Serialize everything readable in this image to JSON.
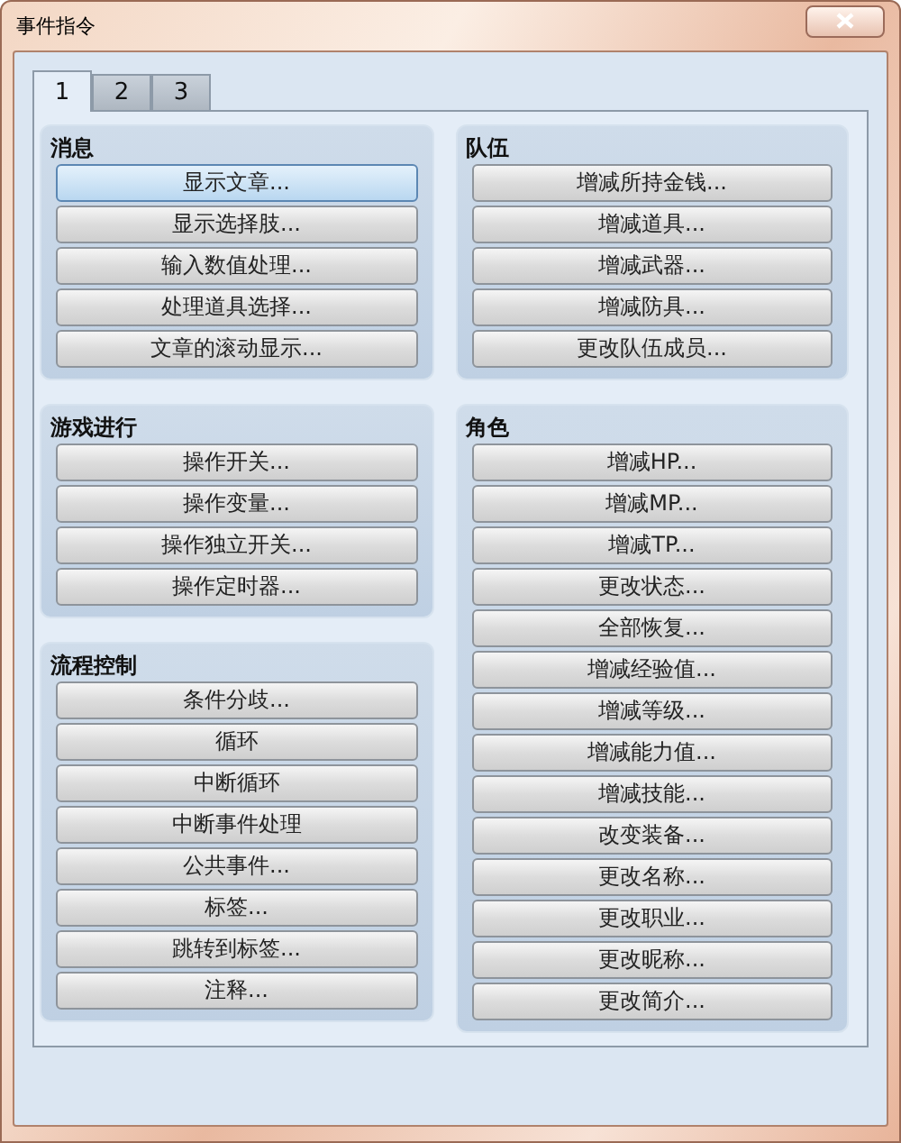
{
  "window": {
    "title": "事件指令"
  },
  "tabs": [
    {
      "label": "1",
      "selected": true
    },
    {
      "label": "2",
      "selected": false
    },
    {
      "label": "3",
      "selected": false
    }
  ],
  "columns": [
    [
      {
        "title": "消息",
        "buttons": [
          {
            "label": "显示文章...",
            "selected": true
          },
          {
            "label": "显示选择肢...",
            "selected": false
          },
          {
            "label": "输入数值处理...",
            "selected": false
          },
          {
            "label": "处理道具选择...",
            "selected": false
          },
          {
            "label": "文章的滚动显示...",
            "selected": false
          }
        ]
      },
      {
        "title": "游戏进行",
        "buttons": [
          {
            "label": "操作开关...",
            "selected": false
          },
          {
            "label": "操作变量...",
            "selected": false
          },
          {
            "label": "操作独立开关...",
            "selected": false
          },
          {
            "label": "操作定时器...",
            "selected": false
          }
        ]
      },
      {
        "title": "流程控制",
        "buttons": [
          {
            "label": "条件分歧...",
            "selected": false
          },
          {
            "label": "循环",
            "selected": false
          },
          {
            "label": "中断循环",
            "selected": false
          },
          {
            "label": "中断事件处理",
            "selected": false
          },
          {
            "label": "公共事件...",
            "selected": false
          },
          {
            "label": "标签...",
            "selected": false
          },
          {
            "label": "跳转到标签...",
            "selected": false
          },
          {
            "label": "注释...",
            "selected": false
          }
        ]
      }
    ],
    [
      {
        "title": "队伍",
        "buttons": [
          {
            "label": "增减所持金钱...",
            "selected": false
          },
          {
            "label": "增减道具...",
            "selected": false
          },
          {
            "label": "增减武器...",
            "selected": false
          },
          {
            "label": "增减防具...",
            "selected": false
          },
          {
            "label": "更改队伍成员...",
            "selected": false
          }
        ]
      },
      {
        "title": "角色",
        "buttons": [
          {
            "label": "增减HP...",
            "selected": false
          },
          {
            "label": "增减MP...",
            "selected": false
          },
          {
            "label": "增减TP...",
            "selected": false
          },
          {
            "label": "更改状态...",
            "selected": false
          },
          {
            "label": "全部恢复...",
            "selected": false
          },
          {
            "label": "增减经验值...",
            "selected": false
          },
          {
            "label": "增减等级...",
            "selected": false
          },
          {
            "label": "增减能力值...",
            "selected": false
          },
          {
            "label": "增减技能...",
            "selected": false
          },
          {
            "label": "改变装备...",
            "selected": false
          },
          {
            "label": "更改名称...",
            "selected": false
          },
          {
            "label": "更改职业...",
            "selected": false
          },
          {
            "label": "更改昵称...",
            "selected": false
          },
          {
            "label": "更改简介...",
            "selected": false
          }
        ]
      }
    ]
  ]
}
